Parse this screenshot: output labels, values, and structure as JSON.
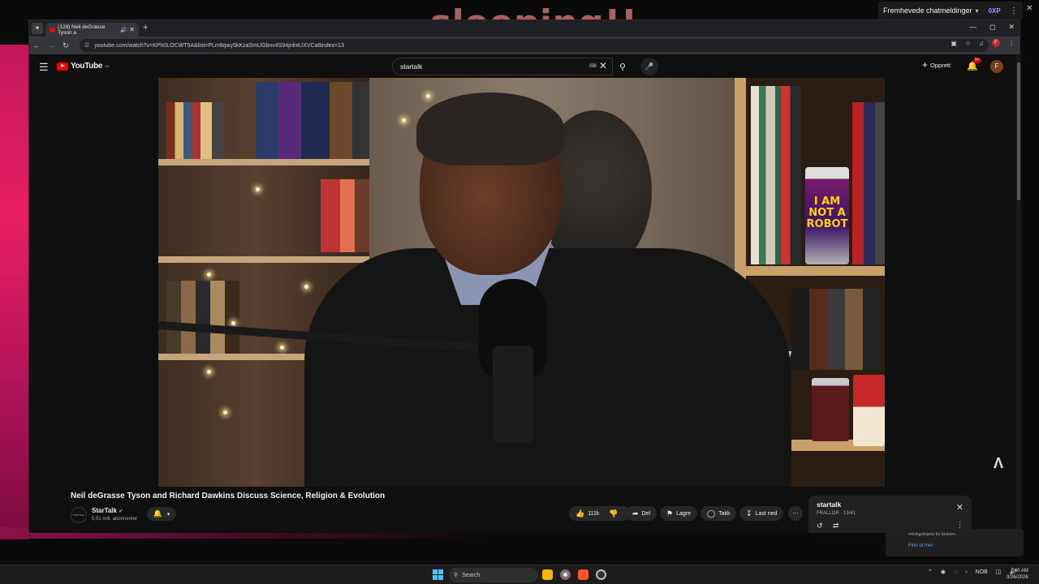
{
  "overlay": {
    "headline": "sleeping!!",
    "chat_widget": {
      "label": "Fremhevede chatmeldinger",
      "xp": "0XP"
    }
  },
  "browser": {
    "tab": {
      "title": "(128) Neil deGrasse Tyson a",
      "audio_icon": "speaker-icon"
    },
    "url": "youtube.com/watch?v=KPh0LOCWT5A&list=PLm8qwy5kKzaSmUGbnv4S94jnlntUXVCa8index=13"
  },
  "youtube": {
    "logo": "YouTube",
    "logo_region": "NO",
    "search": {
      "value": "startalk"
    },
    "create_label": "Opprett",
    "notification_count": "9+",
    "avatar_letter": "F",
    "video": {
      "title": "Neil deGrasse Tyson and Richard Dawkins Discuss Science, Religion & Evolution",
      "can_text": "I AM NOT A ROBOT"
    },
    "channel": {
      "name": "StarTalk",
      "subscribers": "5,51 mill. abonnenter",
      "avatar_text": "STARTALK"
    },
    "actions": {
      "likes": "111k",
      "share": "Del",
      "save": "Lagre",
      "thanks": "Takk",
      "download": "Last ned"
    },
    "playlist": {
      "title": "startalk",
      "meta": "FRALLOR · 13/41"
    }
  },
  "toast": {
    "text": "retningslinjene for brukere.",
    "link": "Finn ut mer"
  },
  "taskbar": {
    "search_placeholder": "Search",
    "language": "NOB",
    "time": "7:40 AM",
    "date": "3/26/2026"
  },
  "colors": {
    "accent_red": "#ff0000",
    "pink_desktop": "#e91e63",
    "overlay_green": "#2fb54a"
  }
}
